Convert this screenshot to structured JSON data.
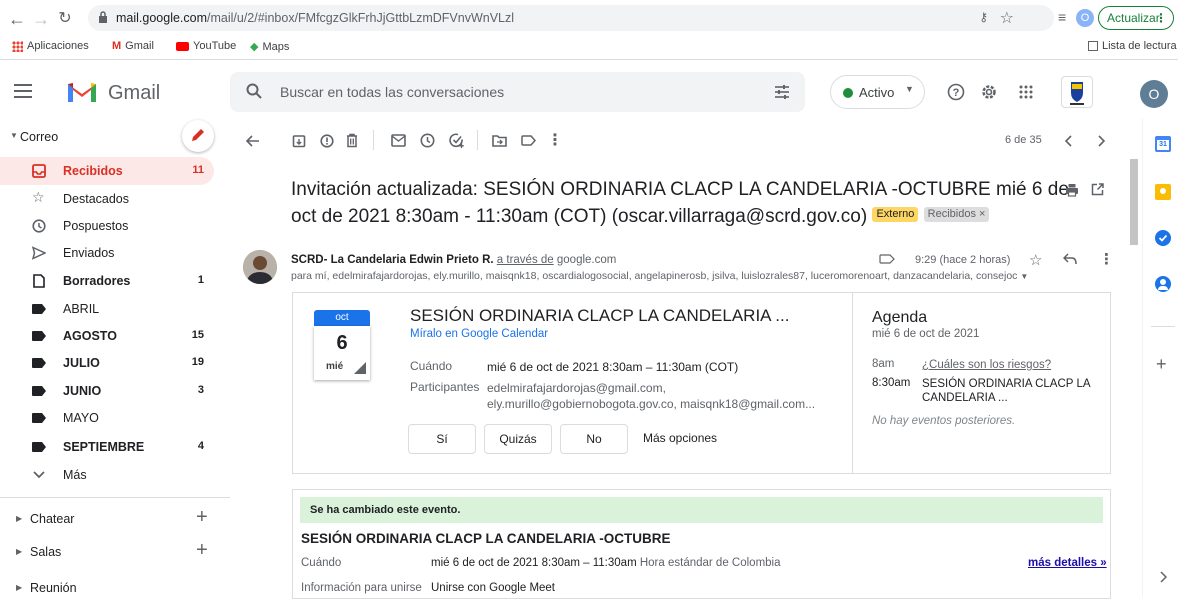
{
  "browser": {
    "url_host": "mail.google.com",
    "url_path": "/mail/u/2/#inbox/FMfcgzGlkFrhJjGttbLzmDFVnvWnVLzl",
    "profile_initial": "O",
    "update_label": "Actualizar",
    "bookmarks": [
      "Aplicaciones",
      "Gmail",
      "YouTube",
      "Maps"
    ],
    "reading_list": "Lista de lectura"
  },
  "header": {
    "app_name": "Gmail",
    "search_placeholder": "Buscar en todas las conversaciones",
    "status_label": "Activo",
    "account_initial": "O"
  },
  "sidebar": {
    "section_title": "Correo",
    "items": [
      {
        "label": "Recibidos",
        "count": "11"
      },
      {
        "label": "Destacados",
        "count": ""
      },
      {
        "label": "Pospuestos",
        "count": ""
      },
      {
        "label": "Enviados",
        "count": ""
      },
      {
        "label": "Borradores",
        "count": "1"
      },
      {
        "label": "ABRIL",
        "count": ""
      },
      {
        "label": "AGOSTO",
        "count": "15"
      },
      {
        "label": "JULIO",
        "count": "19"
      },
      {
        "label": "JUNIO",
        "count": "3"
      },
      {
        "label": "MAYO",
        "count": ""
      },
      {
        "label": "SEPTIEMBRE",
        "count": "4"
      },
      {
        "label": "Más",
        "count": ""
      }
    ],
    "chat": "Chatear",
    "rooms": "Salas",
    "meet": "Reunión"
  },
  "toolbar": {
    "pagination": "6 de 35"
  },
  "email": {
    "subject": "Invitación actualizada: SESIÓN ORDINARIA CLACP LA CANDELARIA -OCTUBRE mié 6 de oct de 2021 8:30am - 11:30am (COT) (oscar.villarraga@scrd.gov.co)",
    "badge_external": "Externo",
    "badge_inbox": "Recibidos ×",
    "sender_name": "SCRD- La Candelaria Edwin Prieto R.",
    "via_text": "a través de",
    "via_domain": "google.com",
    "time": "9:29 (hace 2 horas)",
    "recipients": "para mí, edelmirafajardorojas, ely.murillo, maisqnk18, oscardialogosocial, angelapinerosb, jsilva, luislozrales87, luceromorenoart, danzacandelaria, consejoc"
  },
  "invite": {
    "cal_month": "oct",
    "cal_day": "6",
    "cal_dow": "mié",
    "title": "SESIÓN ORDINARIA CLACP LA CANDELARIA ...",
    "calendar_link": "Míralo en Google Calendar",
    "when_label": "Cuándo",
    "when_value": "mié 6 de oct de 2021 8:30am – 11:30am (COT)",
    "participants_label": "Participantes",
    "participants_line1": "edelmirafajardorojas@gmail.com,",
    "participants_line2": "ely.murillo@gobiernobogota.gov.co, maisqnk18@gmail.com...",
    "rsvp_yes": "Sí",
    "rsvp_maybe": "Quizás",
    "rsvp_no": "No",
    "rsvp_more": "Más opciones",
    "agenda_title": "Agenda",
    "agenda_date": "mié 6 de oct de 2021",
    "agenda_items": [
      {
        "time": "8am",
        "event": "¿Cuáles son los riesgos?"
      },
      {
        "time": "8:30am",
        "event": "SESIÓN ORDINARIA CLACP LA CANDELARIA ..."
      }
    ],
    "no_more": "No hay eventos posteriores."
  },
  "changed": {
    "banner": "Se ha cambiado este evento.",
    "title": "SESIÓN ORDINARIA CLACP LA CANDELARIA -OCTUBRE",
    "when_label": "Cuándo",
    "when_value": "mié 6 de oct de 2021 8:30am – 11:30am",
    "when_tz": "Hora estándar de Colombia",
    "details_link": "más detalles »",
    "join_label": "Información para unirse",
    "join_value": "Unirse con Google Meet"
  },
  "colors": {
    "gmail_red": "#d93025",
    "blue": "#1a73e8",
    "green": "#1e8e3e",
    "external_badge": "#fdd663"
  }
}
